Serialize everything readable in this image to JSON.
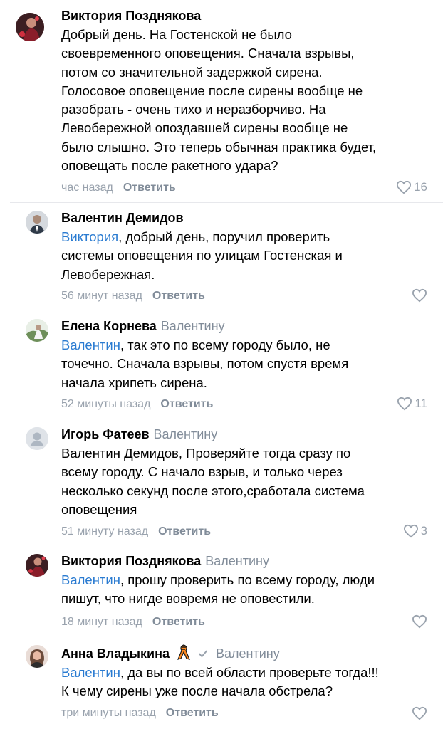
{
  "comments": [
    {
      "author": "Виктория Позднякова",
      "reply_to": "",
      "lines": [
        "Добрый день. На Гостенской не было",
        "своевременного оповещения. Сначала взрывы,",
        "потом со значительной задержкой сирена.",
        "Голосовое оповещение после сирены вообще не",
        "разобрать - очень тихо и неразборчиво. На",
        "Левобережной  опоздавшей сирены вообще не",
        "было слышно. Это теперь обычная практика будет,",
        "оповещать после ракетного удара?"
      ],
      "time": "час назад",
      "reply_label": "Ответить",
      "likes": "16"
    },
    {
      "author": "Валентин Демидов",
      "reply_to": "",
      "mention": "Виктория",
      "lines": [
        ", добрый день, поручил проверить",
        "системы оповещения по улицам Гостенская и",
        "Левобережная."
      ],
      "time": "56 минут назад",
      "reply_label": "Ответить",
      "likes": ""
    },
    {
      "author": "Елена Корнева",
      "reply_to": "Валентину",
      "mention": "Валентин",
      "lines": [
        ", так это по всему городу было, не",
        "точечно. Сначала взрывы, потом спустя время",
        "начала хрипеть сирена."
      ],
      "time": "52 минуты назад",
      "reply_label": "Ответить",
      "likes": "11"
    },
    {
      "author": "Игорь Фатеев",
      "reply_to": "Валентину",
      "lines": [
        "Валентин Демидов, Проверяйте тогда сразу по",
        "всему городу. С начало взрыв, и только через",
        "несколько секунд после этого,сработала система",
        "оповещения"
      ],
      "time": "51 минуту назад",
      "reply_label": "Ответить",
      "likes": "3"
    },
    {
      "author": "Виктория Позднякова",
      "reply_to": "Валентину",
      "mention": "Валентин",
      "lines": [
        ", прошу проверить по всему городу, люди",
        "пишут, что нигде вовремя не оповестили."
      ],
      "time": "18 минут назад",
      "reply_label": "Ответить",
      "likes": ""
    },
    {
      "author": "Анна Владыкина",
      "reply_to": "Валентину",
      "mention": "Валентин",
      "lines": [
        ", да вы по всей области проверьте тогда!!!",
        "К чему сирены уже после начала обстрела?"
      ],
      "time": "три минуты назад",
      "reply_label": "Ответить",
      "likes": ""
    }
  ],
  "colors": {
    "mention": "#2a7bd1",
    "secondary": "#818c99",
    "divider": "#e7e8ec"
  },
  "icons": [
    "heart-icon",
    "verified-icon",
    "ribbon-icon",
    "default-avatar-icon"
  ]
}
